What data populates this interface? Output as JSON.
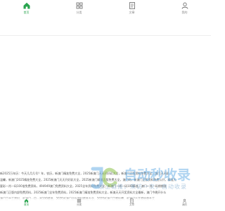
{
  "top_tabs": [
    {
      "label": "首页",
      "icon": "home-icon",
      "active": true
    },
    {
      "label": "分类",
      "icon": "grid-icon",
      "active": false
    },
    {
      "label": "文章",
      "icon": "doc-icon",
      "active": false
    },
    {
      "label": "我的",
      "icon": "user-icon",
      "active": false
    }
  ],
  "ticker_rows": [
    "新2025万年历：今天几月几号？年，农历，新澳门精准免费大全，2025新澳门天天开好彩大全，新澳门正版资料免费大全，澳门天天彩",
    "温馨，新澳门2025精准免费大全，2025新澳门天天开好彩大全，2025新澳门精准正版免费大全，澳门码，新澳门正版资料免费公开，精准大",
    "要彩一肖一码100准免费资料，494949澳门免费资料大全，2025全年资料免费大全，新澳门一肖一码100精准，澳门一肖一码期期准",
    "新澳门正版内部免费资料，2025新澳门全年免费资料，2025新澳门精准免费资料大全，新澳天天开奖资料大全最新，澳门今晚开什么",
    "澳门王中王资料，新澳门一码一肖100精准，2025新澳门全年资料精准大全，2025新澳门正版挂牌，新澳门六开奖结果今天"
  ],
  "bottom_nav": [
    {
      "label": "首页",
      "icon": "home-icon",
      "active": true
    },
    {
      "label": "分类",
      "icon": "grid-icon",
      "active": false
    },
    {
      "label": "文章",
      "icon": "doc-icon",
      "active": false
    },
    {
      "label": "我的",
      "icon": "user-icon",
      "active": false
    }
  ],
  "watermark": {
    "title": "自动秒收录",
    "subtitle": "放上链接，来访一次，自动收录",
    "color": "#6fb2e6"
  },
  "colors": {
    "accent": "#2aa44f",
    "muted": "#888888"
  }
}
